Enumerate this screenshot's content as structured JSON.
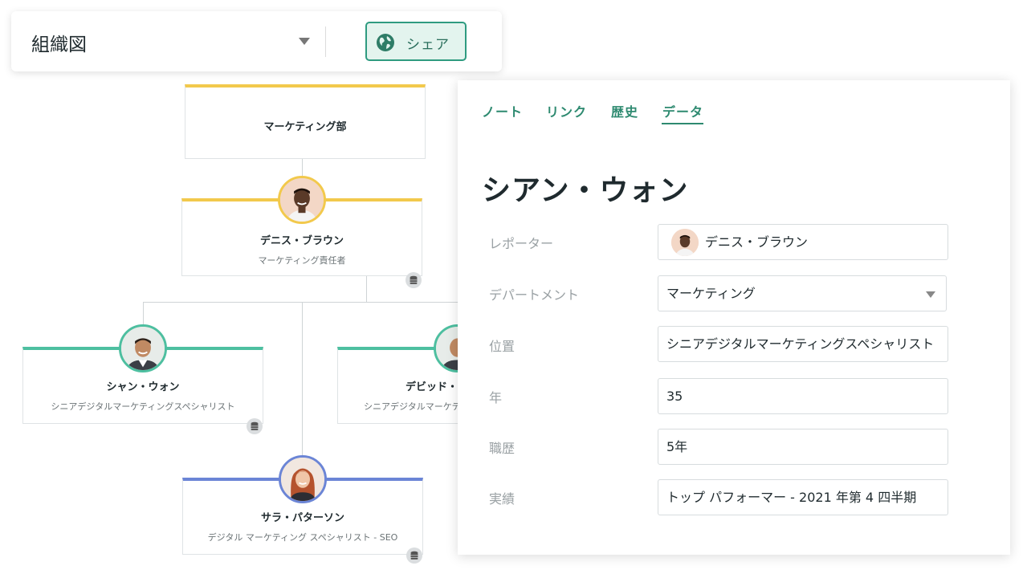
{
  "toolbar": {
    "title": "組織図",
    "share_label": "シェア"
  },
  "org": {
    "department": {
      "name": "マーケティング部"
    },
    "manager": {
      "name": "デニス・ブラウン",
      "role": "マーケティング責任者"
    },
    "left": {
      "name": "シャン・ウォン",
      "role": "シニアデジタルマーケティングスペシャリスト"
    },
    "right": {
      "name": "デビッド・",
      "role": "シニアデジタルマーケテ"
    },
    "bottom": {
      "name": "サラ・パターソン",
      "role": "デジタル マーケティング スペシャリスト - SEO"
    }
  },
  "panel": {
    "tabs": [
      "ノート",
      "リンク",
      "歴史",
      "データ"
    ],
    "active_tab": "データ",
    "title": "シアン・ウォン",
    "fields": [
      {
        "label": "レポーター",
        "value": "デニス・ブラウン"
      },
      {
        "label": "デパートメント",
        "value": "マーケティング"
      },
      {
        "label": "位置",
        "value": "シニアデジタルマーケティングスペシャリスト"
      },
      {
        "label": "年",
        "value": "35"
      },
      {
        "label": "職歴",
        "value": "5年"
      },
      {
        "label": "実績",
        "value": "トップ パフォーマー - 2021 年第 4 四半期"
      }
    ]
  },
  "colors": {
    "accent": "#2e8a70",
    "yellow_node": "#f2c94c",
    "teal_node": "#4dbfa0",
    "blue_node": "#6b85d6"
  },
  "icons": [
    "chevron-down-icon",
    "globe-icon",
    "database-icon"
  ]
}
